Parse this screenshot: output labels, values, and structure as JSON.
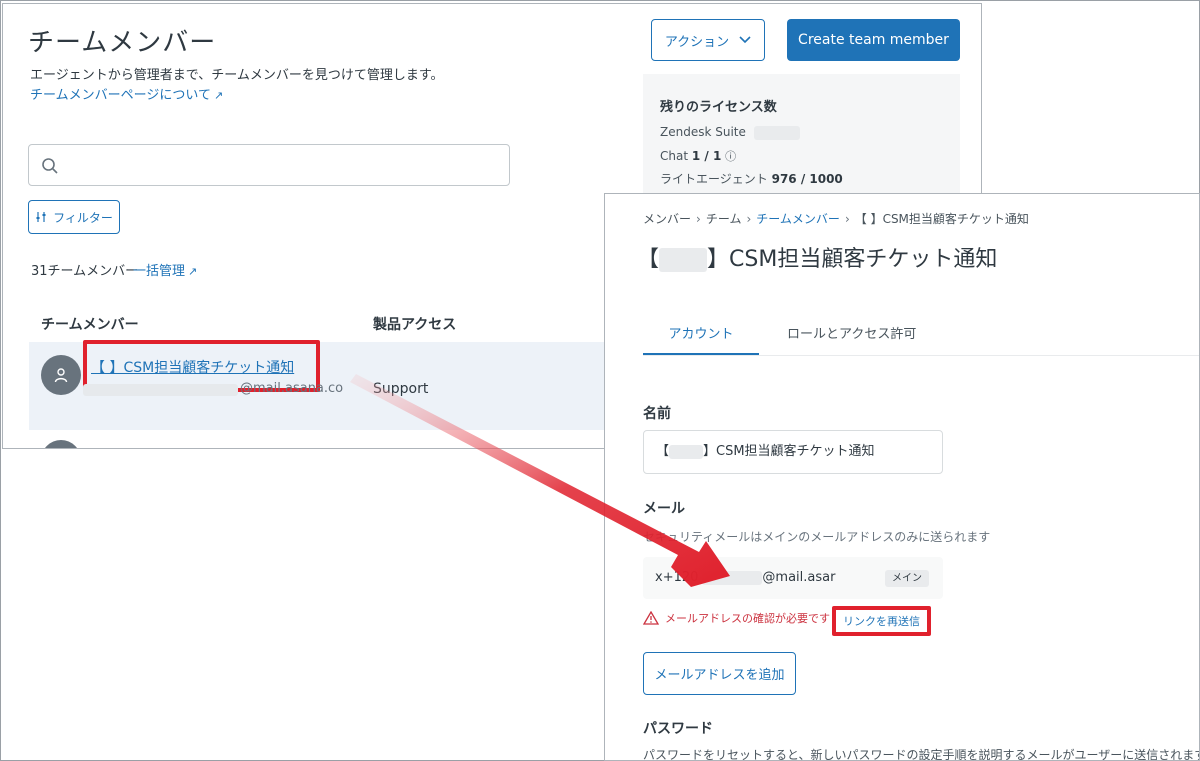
{
  "members_page": {
    "title": "チームメンバー",
    "subtitle": "エージェントから管理者まで、チームメンバーを見つけて管理します。",
    "about_link": "チームメンバーページについて",
    "action_button": "アクション",
    "create_button": "Create team member",
    "license": {
      "title": "残りのライセンス数",
      "zendesk_suite": "Zendesk Suite",
      "chat_label": "Chat",
      "chat_value": "1 / 1",
      "light_agent_label": "ライトエージェント",
      "light_agent_value": "976 / 1000"
    },
    "filter_button": "フィルター",
    "member_count": "31チームメンバー",
    "bulk_manage_link": "一括管理",
    "columns": [
      "チームメンバー",
      "製品アクセス"
    ],
    "rows": [
      {
        "name": "【 】CSM担当顧客チケット通知",
        "email": "@mail.asana.co",
        "product": "Support"
      }
    ]
  },
  "member_detail": {
    "breadcrumb": [
      "メンバー",
      "チーム",
      "チームメンバー",
      "【 】CSM担当顧客チケット通知"
    ],
    "title_prefix": "【",
    "title_suffix": "】CSM担当顧客チケット通知",
    "tabs": [
      "アカウント",
      "ロールとアクセス許可"
    ],
    "name_label": "名前",
    "name_prefix": "【",
    "name_suffix": "】CSM担当顧客チケット通知",
    "email_label": "メール",
    "email_hint": "セキュリティメールはメインのメールアドレスのみに送られます",
    "email_prefix": "x+120",
    "email_suffix": "@mail.asar",
    "email_badge": "メイン",
    "warning": "メールアドレスの確認が必要です",
    "resend_link": "リンクを再送信",
    "add_email_button": "メールアドレスを追加",
    "password_label": "パスワード",
    "password_desc": "パスワードをリセットすると、新しいパスワードの設定手順を説明するメールがユーザーに送信されます"
  },
  "colors": {
    "accent": "#1f73b7",
    "highlight_red": "#e0212d",
    "row_bg": "#edf2f8"
  }
}
